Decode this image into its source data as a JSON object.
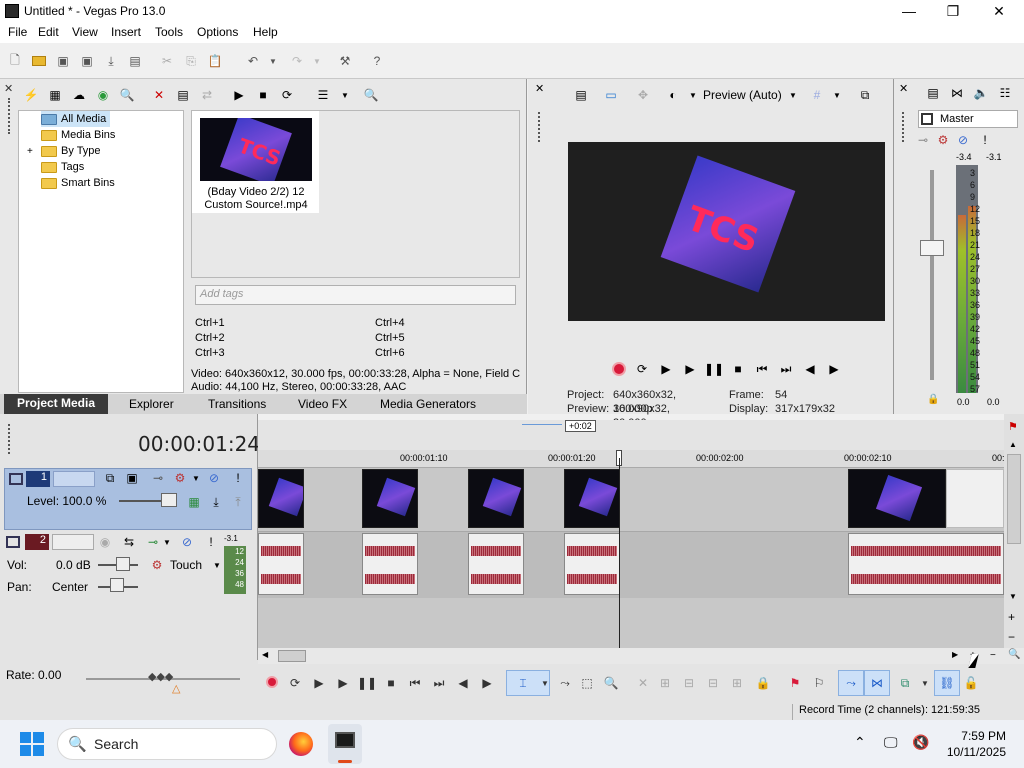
{
  "window": {
    "title": "Untitled * - Vegas Pro 13.0",
    "minimize": "—",
    "maximize": "❐",
    "close": "✕"
  },
  "menu": [
    "File",
    "Edit",
    "View",
    "Insert",
    "Tools",
    "Options",
    "Help"
  ],
  "explorer": {
    "tree": [
      {
        "label": "All Media",
        "expand": ""
      },
      {
        "label": "Media Bins",
        "expand": ""
      },
      {
        "label": "By Type",
        "expand": "+"
      },
      {
        "label": "Tags",
        "expand": ""
      },
      {
        "label": "Smart Bins",
        "expand": ""
      }
    ],
    "media_item": {
      "label_line1": "(Bday Video 2/2) 12",
      "label_line2": "Custom Source!.mp4",
      "thumb_text": "TCS"
    },
    "tags_placeholder": "Add tags",
    "shortcuts": [
      "Ctrl+1",
      "Ctrl+4",
      "Ctrl+2",
      "Ctrl+5",
      "Ctrl+3",
      "Ctrl+6"
    ],
    "info_video": "Video: 640x360x12, 30.000 fps, 00:00:33:28, Alpha = None, Field C",
    "info_audio": "Audio: 44,100 Hz, Stereo, 00:00:33:28, AAC"
  },
  "tabs": [
    "Project Media",
    "Explorer",
    "Transitions",
    "Video FX",
    "Media Generators"
  ],
  "preview": {
    "mode": "Preview (Auto)",
    "project_label": "Project:",
    "project_value": "640x360x32, 30.000p",
    "frame_label": "Frame:",
    "frame_value": "54",
    "preview_label": "Preview:",
    "preview_value": "160x90x32, 30.000p",
    "display_label": "Display:",
    "display_value": "317x179x32"
  },
  "master": {
    "label": "Master",
    "peak_left": "-3.4",
    "peak_right": "-3.1",
    "scale": [
      "3",
      "6",
      "9",
      "12",
      "15",
      "18",
      "21",
      "24",
      "27",
      "30",
      "33",
      "36",
      "39",
      "42",
      "45",
      "48",
      "51",
      "54",
      "57"
    ],
    "bottom_left": "0.0",
    "bottom_right": "0.0",
    "level_left": 0.78,
    "level_right": 0.82
  },
  "timeline": {
    "cursor_time": "00:00:01:24",
    "offset": "+0:02",
    "ruler": [
      "00:00:01:10",
      "00:00:01:20",
      "00:00:02:00",
      "00:00:02:10",
      "00:"
    ],
    "track1": {
      "number": "1",
      "level": "Level: 100.0 %"
    },
    "track2": {
      "number": "2",
      "peak": "-3.1",
      "meter_marks": [
        "12",
        "24",
        "36",
        "48"
      ],
      "vol_label": "Vol:",
      "vol_value": "0.0 dB",
      "pan_label": "Pan:",
      "pan_value": "Center",
      "automation": "Touch"
    },
    "rate": "Rate: 0.00"
  },
  "status": {
    "record_time": "Record Time (2 channels): 121:59:35"
  },
  "taskbar": {
    "search": "Search",
    "time": "7:59 PM",
    "date": "10/11/2025"
  }
}
